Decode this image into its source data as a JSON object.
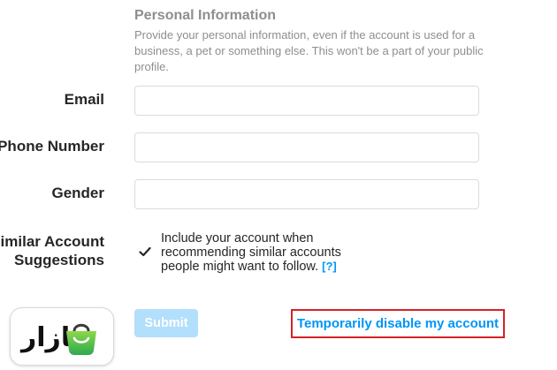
{
  "personal_info": {
    "title": "Personal Information",
    "description": "Provide your personal information, even if the account is used for a business, a pet or something else. This won't be a part of your public profile."
  },
  "fields": {
    "email": {
      "label": "Email",
      "value": ""
    },
    "phone": {
      "label": "Phone Number",
      "value": ""
    },
    "gender": {
      "label": "Gender",
      "value": ""
    }
  },
  "similar_accounts": {
    "label_line1": "Similar Account",
    "label_line2": "Suggestions",
    "checkbox_checked": true,
    "checkbox_text": "Include your account when recommending similar accounts people might want to follow.",
    "help_link": "[?]"
  },
  "actions": {
    "submit_label": "Submit",
    "disable_link": "Temporarily disable my account"
  },
  "watermark": {
    "logo_text": "بازار",
    "icon": "shopping-bag-icon"
  },
  "colors": {
    "link_blue": "#0095f6",
    "submit_disabled": "#b2dffc",
    "highlight_red": "#d62226",
    "logo_green": "#62c13b"
  }
}
